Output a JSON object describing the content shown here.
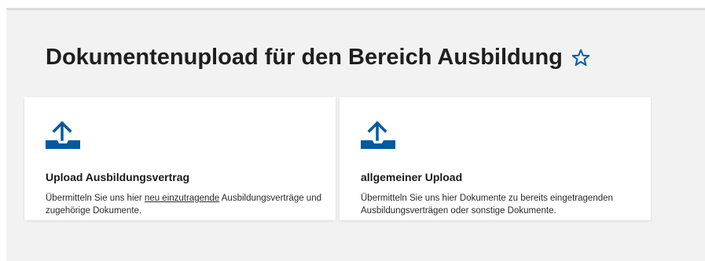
{
  "page": {
    "title": "Dokumentenupload für den Bereich Ausbildung",
    "accent_color": "#005aa0",
    "favorite_icon": "star-outline-icon"
  },
  "cards": [
    {
      "icon": "upload-icon",
      "title": "Upload Ausbildungsvertrag",
      "desc_before": "Übermitteln Sie uns hier ",
      "desc_link": "neu einzutragende",
      "desc_after": " Ausbildungsverträge und zugehörige Dokumente."
    },
    {
      "icon": "upload-icon",
      "title": "allgemeiner Upload",
      "desc": "Übermitteln Sie uns hier Dokumente zu bereits eingetragenden Ausbildungsverträgen oder sonstige Dokumente."
    }
  ]
}
